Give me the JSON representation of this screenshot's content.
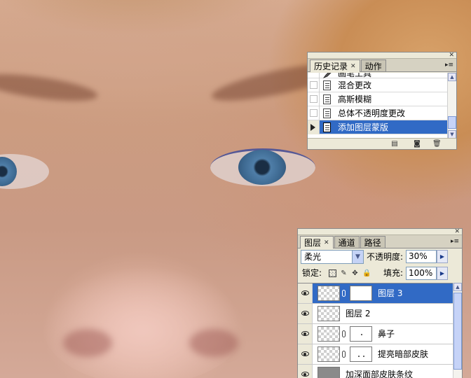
{
  "history_panel": {
    "tabs": [
      {
        "label": "历史记录",
        "active": true
      },
      {
        "label": "动作",
        "active": false
      }
    ],
    "items": [
      {
        "label": "画笔工具",
        "icon": "brush-icon",
        "selected": false
      },
      {
        "label": "混合更改",
        "icon": "history-state-icon",
        "selected": false
      },
      {
        "label": "高斯模糊",
        "icon": "history-state-icon",
        "selected": false
      },
      {
        "label": "总体不透明度更改",
        "icon": "history-state-icon",
        "selected": false
      },
      {
        "label": "添加图层蒙版",
        "icon": "history-state-icon",
        "selected": true
      }
    ]
  },
  "layers_panel": {
    "tabs": [
      {
        "label": "图层",
        "active": true
      },
      {
        "label": "通道",
        "active": false
      },
      {
        "label": "路径",
        "active": false
      }
    ],
    "blend_mode": "柔光",
    "opacity_label": "不透明度:",
    "opacity_value": "30%",
    "lock_label": "锁定:",
    "fill_label": "填充:",
    "fill_value": "100%",
    "layers": [
      {
        "name": "图层 3",
        "visible": true,
        "has_mask": true,
        "selected": true
      },
      {
        "name": "图层 2",
        "visible": true,
        "has_mask": false,
        "selected": false
      },
      {
        "name": "鼻子",
        "visible": true,
        "has_mask": true,
        "selected": false
      },
      {
        "name": "提亮暗部皮肤",
        "visible": true,
        "has_mask": true,
        "selected": false
      },
      {
        "name": "加深面部皮肤条纹",
        "visible": true,
        "has_mask": false,
        "selected": false
      }
    ]
  },
  "colors": {
    "selection": "#316ac5",
    "panel_bg": "#ece9d8"
  }
}
